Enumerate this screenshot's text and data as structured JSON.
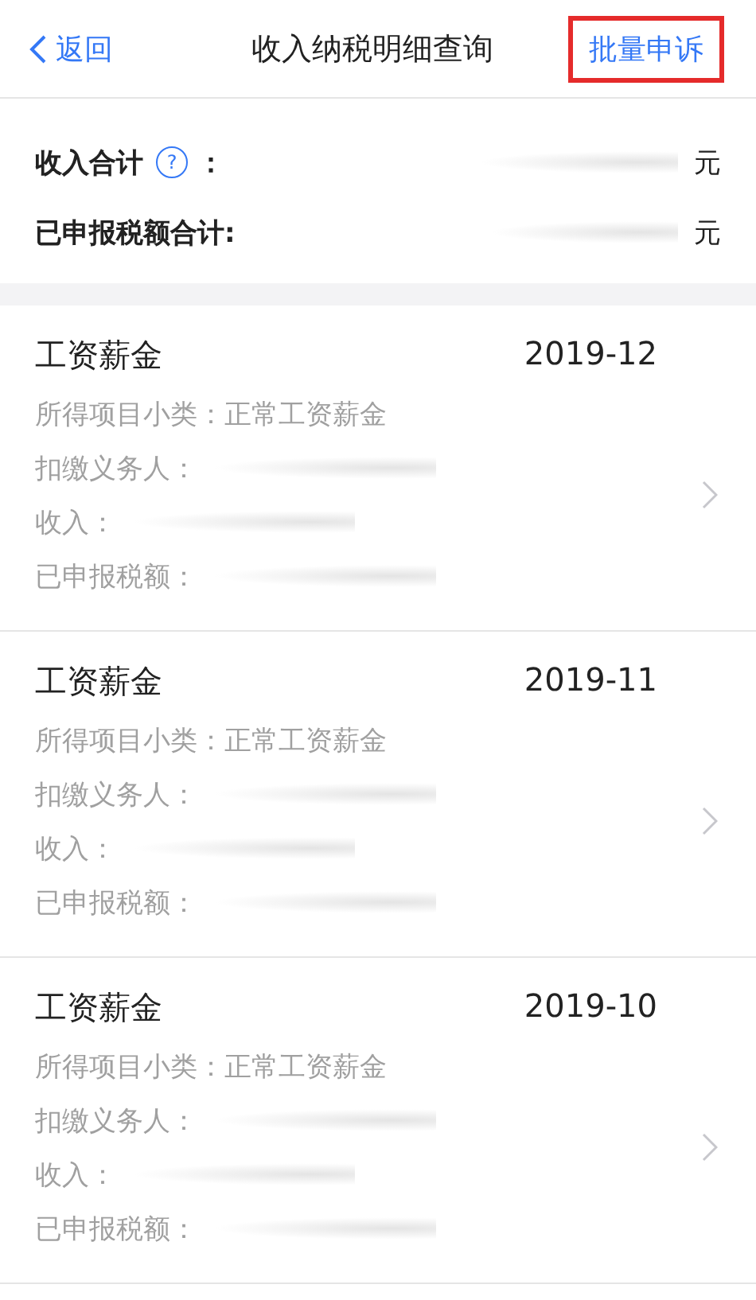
{
  "nav": {
    "back": "返回",
    "title": "收入纳税明细查询",
    "action": {
      "label": "批量申诉",
      "highlighted": true
    }
  },
  "summary": [
    {
      "label": "收入合计",
      "help": "?",
      "colon": "：",
      "unit": "元"
    },
    {
      "label": "已申报税额合计:",
      "unit": "元"
    }
  ],
  "records": [
    {
      "title": "工资薪金",
      "period": "2019-12",
      "fields": [
        "所得项目小类：正常工资薪金",
        "扣缴义务人：",
        "收入：",
        "已申报税额："
      ]
    },
    {
      "title": "工资薪金",
      "period": "2019-11",
      "fields": [
        "所得项目小类：正常工资薪金",
        "扣缴义务人：",
        "收入：",
        "已申报税额："
      ]
    },
    {
      "title": "工资薪金",
      "period": "2019-10",
      "fields": [
        "所得项目小类：正常工资薪金",
        "扣缴义务人：",
        "收入：",
        "已申报税额："
      ]
    }
  ]
}
